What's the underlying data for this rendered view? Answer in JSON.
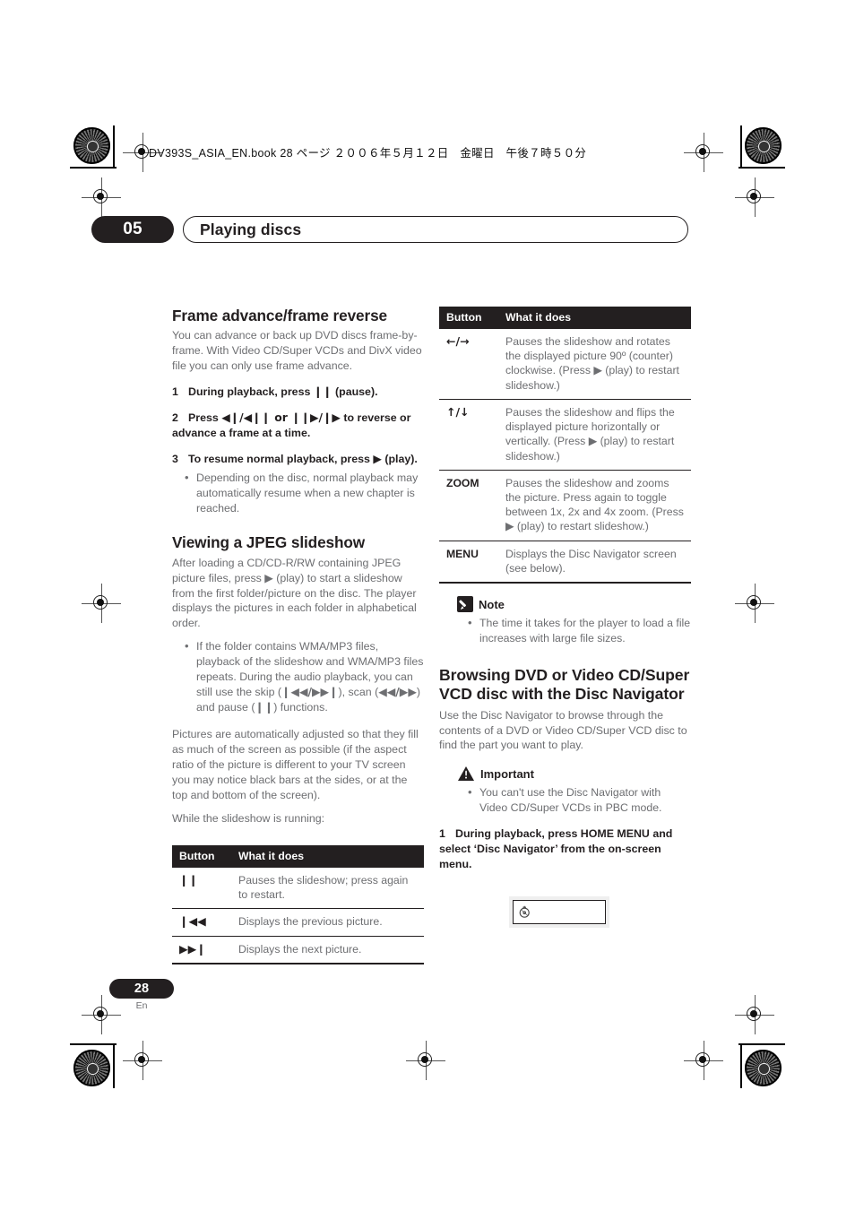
{
  "print_marks": {
    "imposition_line": "DV393S_ASIA_EN.book  28 ページ  ２００６年５月１２日　金曜日　午後７時５０分"
  },
  "chapter": {
    "number": "05",
    "title": "Playing discs"
  },
  "left_column": {
    "section1": {
      "heading": "Frame advance/frame reverse",
      "intro": "You can advance or back up DVD discs frame-by-frame. With Video CD/Super VCDs and DivX video file you can only use frame advance.",
      "steps": [
        {
          "n": "1",
          "text_before": "During playback, press ",
          "symbol": "❙❙",
          "text_after": " (pause)."
        },
        {
          "n": "2",
          "text_before": "Press ",
          "symbol": "◀❙/◀❙❙ or ❙❙▶/❙▶",
          "text_after": " to reverse or advance a frame at a time."
        },
        {
          "n": "3",
          "text_before": "To resume normal playback, press ",
          "symbol": "▶",
          "text_after": " (play)."
        }
      ],
      "bullets": [
        "Depending on the disc, normal playback may automatically resume when a new chapter is reached."
      ]
    },
    "section2": {
      "heading": "Viewing a JPEG slideshow",
      "intro_a": "After loading a CD/CD-R/RW containing JPEG picture files, press ",
      "intro_symbol": "▶",
      "intro_b": " (play) to start a slideshow from the first folder/picture on the disc. The player displays the pictures in each folder in alphabetical order.",
      "bullet_a": "If the folder contains WMA/MP3 files, playback of the slideshow and WMA/MP3 files repeats. During the audio playback, you can still use the skip (",
      "bullet_sym1": "❙◀◀/▶▶❙",
      "bullet_b": "), scan (",
      "bullet_sym2": "◀◀/▶▶",
      "bullet_c": ") and pause (",
      "bullet_sym3": "❙❙",
      "bullet_d": ") functions.",
      "para2": "Pictures are automatically adjusted so that they fill as much of the screen as possible (if the aspect ratio of the picture is different to your TV screen you may notice black bars at the sides, or at the top and bottom of the screen).",
      "para3": "While the slideshow is running:"
    },
    "table": {
      "headers": [
        "Button",
        "What it does"
      ],
      "rows": [
        {
          "button": "❙❙",
          "button_is_word": false,
          "what": "Pauses the slideshow; press again to restart."
        },
        {
          "button": "❙◀◀",
          "button_is_word": false,
          "what": "Displays the previous picture."
        },
        {
          "button": "▶▶❙",
          "button_is_word": false,
          "what": "Displays the next picture."
        }
      ]
    }
  },
  "right_column": {
    "table": {
      "headers": [
        "Button",
        "What it does"
      ],
      "rows": [
        {
          "button": "←/→",
          "button_is_word": false,
          "what": "Pauses the slideshow and rotates the displayed picture 90º (counter) clockwise. (Press ▶ (play) to restart slideshow.)"
        },
        {
          "button": "↑/↓",
          "button_is_word": false,
          "what": "Pauses the slideshow and flips the displayed picture horizontally or vertically. (Press ▶ (play) to restart slideshow.)"
        },
        {
          "button": "ZOOM",
          "button_is_word": true,
          "what": "Pauses the slideshow and zooms the picture. Press again to toggle between 1x, 2x and 4x zoom. (Press ▶ (play) to restart slideshow.)"
        },
        {
          "button": "MENU",
          "button_is_word": true,
          "what": "Displays the Disc Navigator screen (see below)."
        }
      ]
    },
    "note": {
      "label": "Note",
      "bullets": [
        "The time it takes for the player to load a file increases with large file sizes."
      ]
    },
    "section": {
      "heading": "Browsing DVD or Video CD/Super VCD disc with the Disc Navigator",
      "intro": "Use the Disc Navigator to browse through the contents of a DVD or Video CD/Super VCD disc to find the part you want to play."
    },
    "important": {
      "label": "Important",
      "bullets": [
        "You can't use the Disc Navigator with Video CD/Super VCDs in PBC mode."
      ]
    },
    "step1": {
      "n": "1",
      "text": "During playback, press HOME MENU and select ‘Disc Navigator’ from the on-screen menu."
    },
    "osd": {
      "icon": "disc-icon"
    }
  },
  "footer": {
    "page_number": "28",
    "language": "En"
  },
  "colors": {
    "ink_black": "#231f20",
    "body_gray": "#6d6e71",
    "osd_backdrop": "#efefef"
  }
}
